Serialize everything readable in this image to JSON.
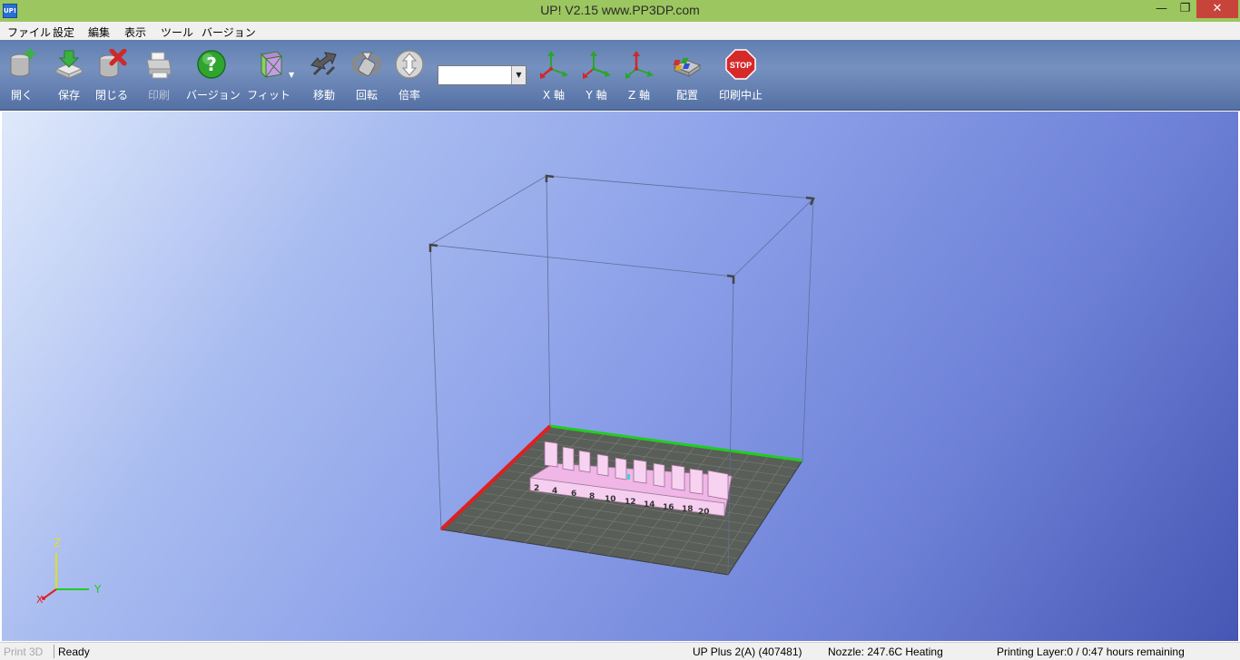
{
  "window": {
    "title": "UP!  V2.15 www.PP3DP.com",
    "icon_text": "UP!"
  },
  "menu": [
    "ファイル",
    "設定",
    "編集",
    "表示",
    "ツール",
    "バージョン"
  ],
  "toolbar": {
    "open": "開く",
    "save": "保存",
    "close": "閉じる",
    "print": "印刷",
    "version": "バージョン",
    "fit": "フィット",
    "move": "移動",
    "rotate": "回転",
    "scale": "倍率",
    "x_axis": "X 軸",
    "y_axis": "Y 軸",
    "z_axis": "Z 軸",
    "arrange": "配置",
    "stop": "印刷中止",
    "stop_sign": "STOP",
    "scale_value": ""
  },
  "model": {
    "labels": [
      "2",
      "4",
      "6",
      "8",
      "10",
      "12",
      "14",
      "16",
      "18",
      "20"
    ]
  },
  "axis_gizmo": {
    "x": "X",
    "y": "Y",
    "z": "Z"
  },
  "status": {
    "mode": "Print 3D",
    "state": "Ready",
    "printer": "UP Plus 2(A) (407481)",
    "nozzle": "Nozzle: 247.6C Heating",
    "progress": "Printing Layer:0 / 0:47 hours remaining"
  },
  "colors": {
    "title_bar": "#9cc65f",
    "toolbar": "#6a87b8",
    "platform": "#5a5e58",
    "model": "#f4c4ee",
    "axis_x": "#e02020",
    "axis_y": "#22cc22",
    "axis_z": "#e0e020"
  }
}
